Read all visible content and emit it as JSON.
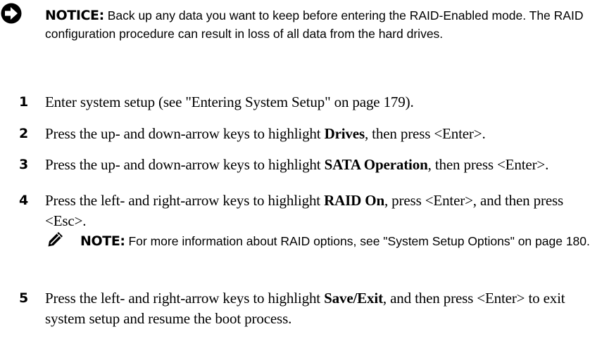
{
  "notice": {
    "icon": "notice-arrow-icon",
    "title": "NOTICE:",
    "text": "Back up any data you want to keep before entering the RAID-Enabled mode. The RAID configuration procedure can result in loss of all data from the hard drives."
  },
  "steps": [
    {
      "number": "1",
      "text_before": "Enter system setup (see \"Entering System Setup\" on page 179).",
      "bold": "",
      "text_after": ""
    },
    {
      "number": "2",
      "text_before": "Press the up- and down-arrow keys to highlight ",
      "bold": "Drives",
      "text_after": ", then press <Enter>."
    },
    {
      "number": "3",
      "text_before": "Press the up- and down-arrow keys to highlight ",
      "bold": "SATA Operation",
      "text_after": ", then press <Enter>."
    },
    {
      "number": "4",
      "text_before": "Press the left- and right-arrow keys to highlight ",
      "bold": "RAID On",
      "text_after": ", press <Enter>, and then press <Esc>."
    },
    {
      "number": "5",
      "text_before": "Press the left- and right-arrow keys to highlight ",
      "bold": "Save/Exit",
      "text_after": ", and then press <Enter> to exit system setup and resume the boot process."
    }
  ],
  "note": {
    "icon": "note-pencil-icon",
    "title": "NOTE:",
    "text": "For more information about RAID options, see \"System Setup Options\" on page 180."
  }
}
